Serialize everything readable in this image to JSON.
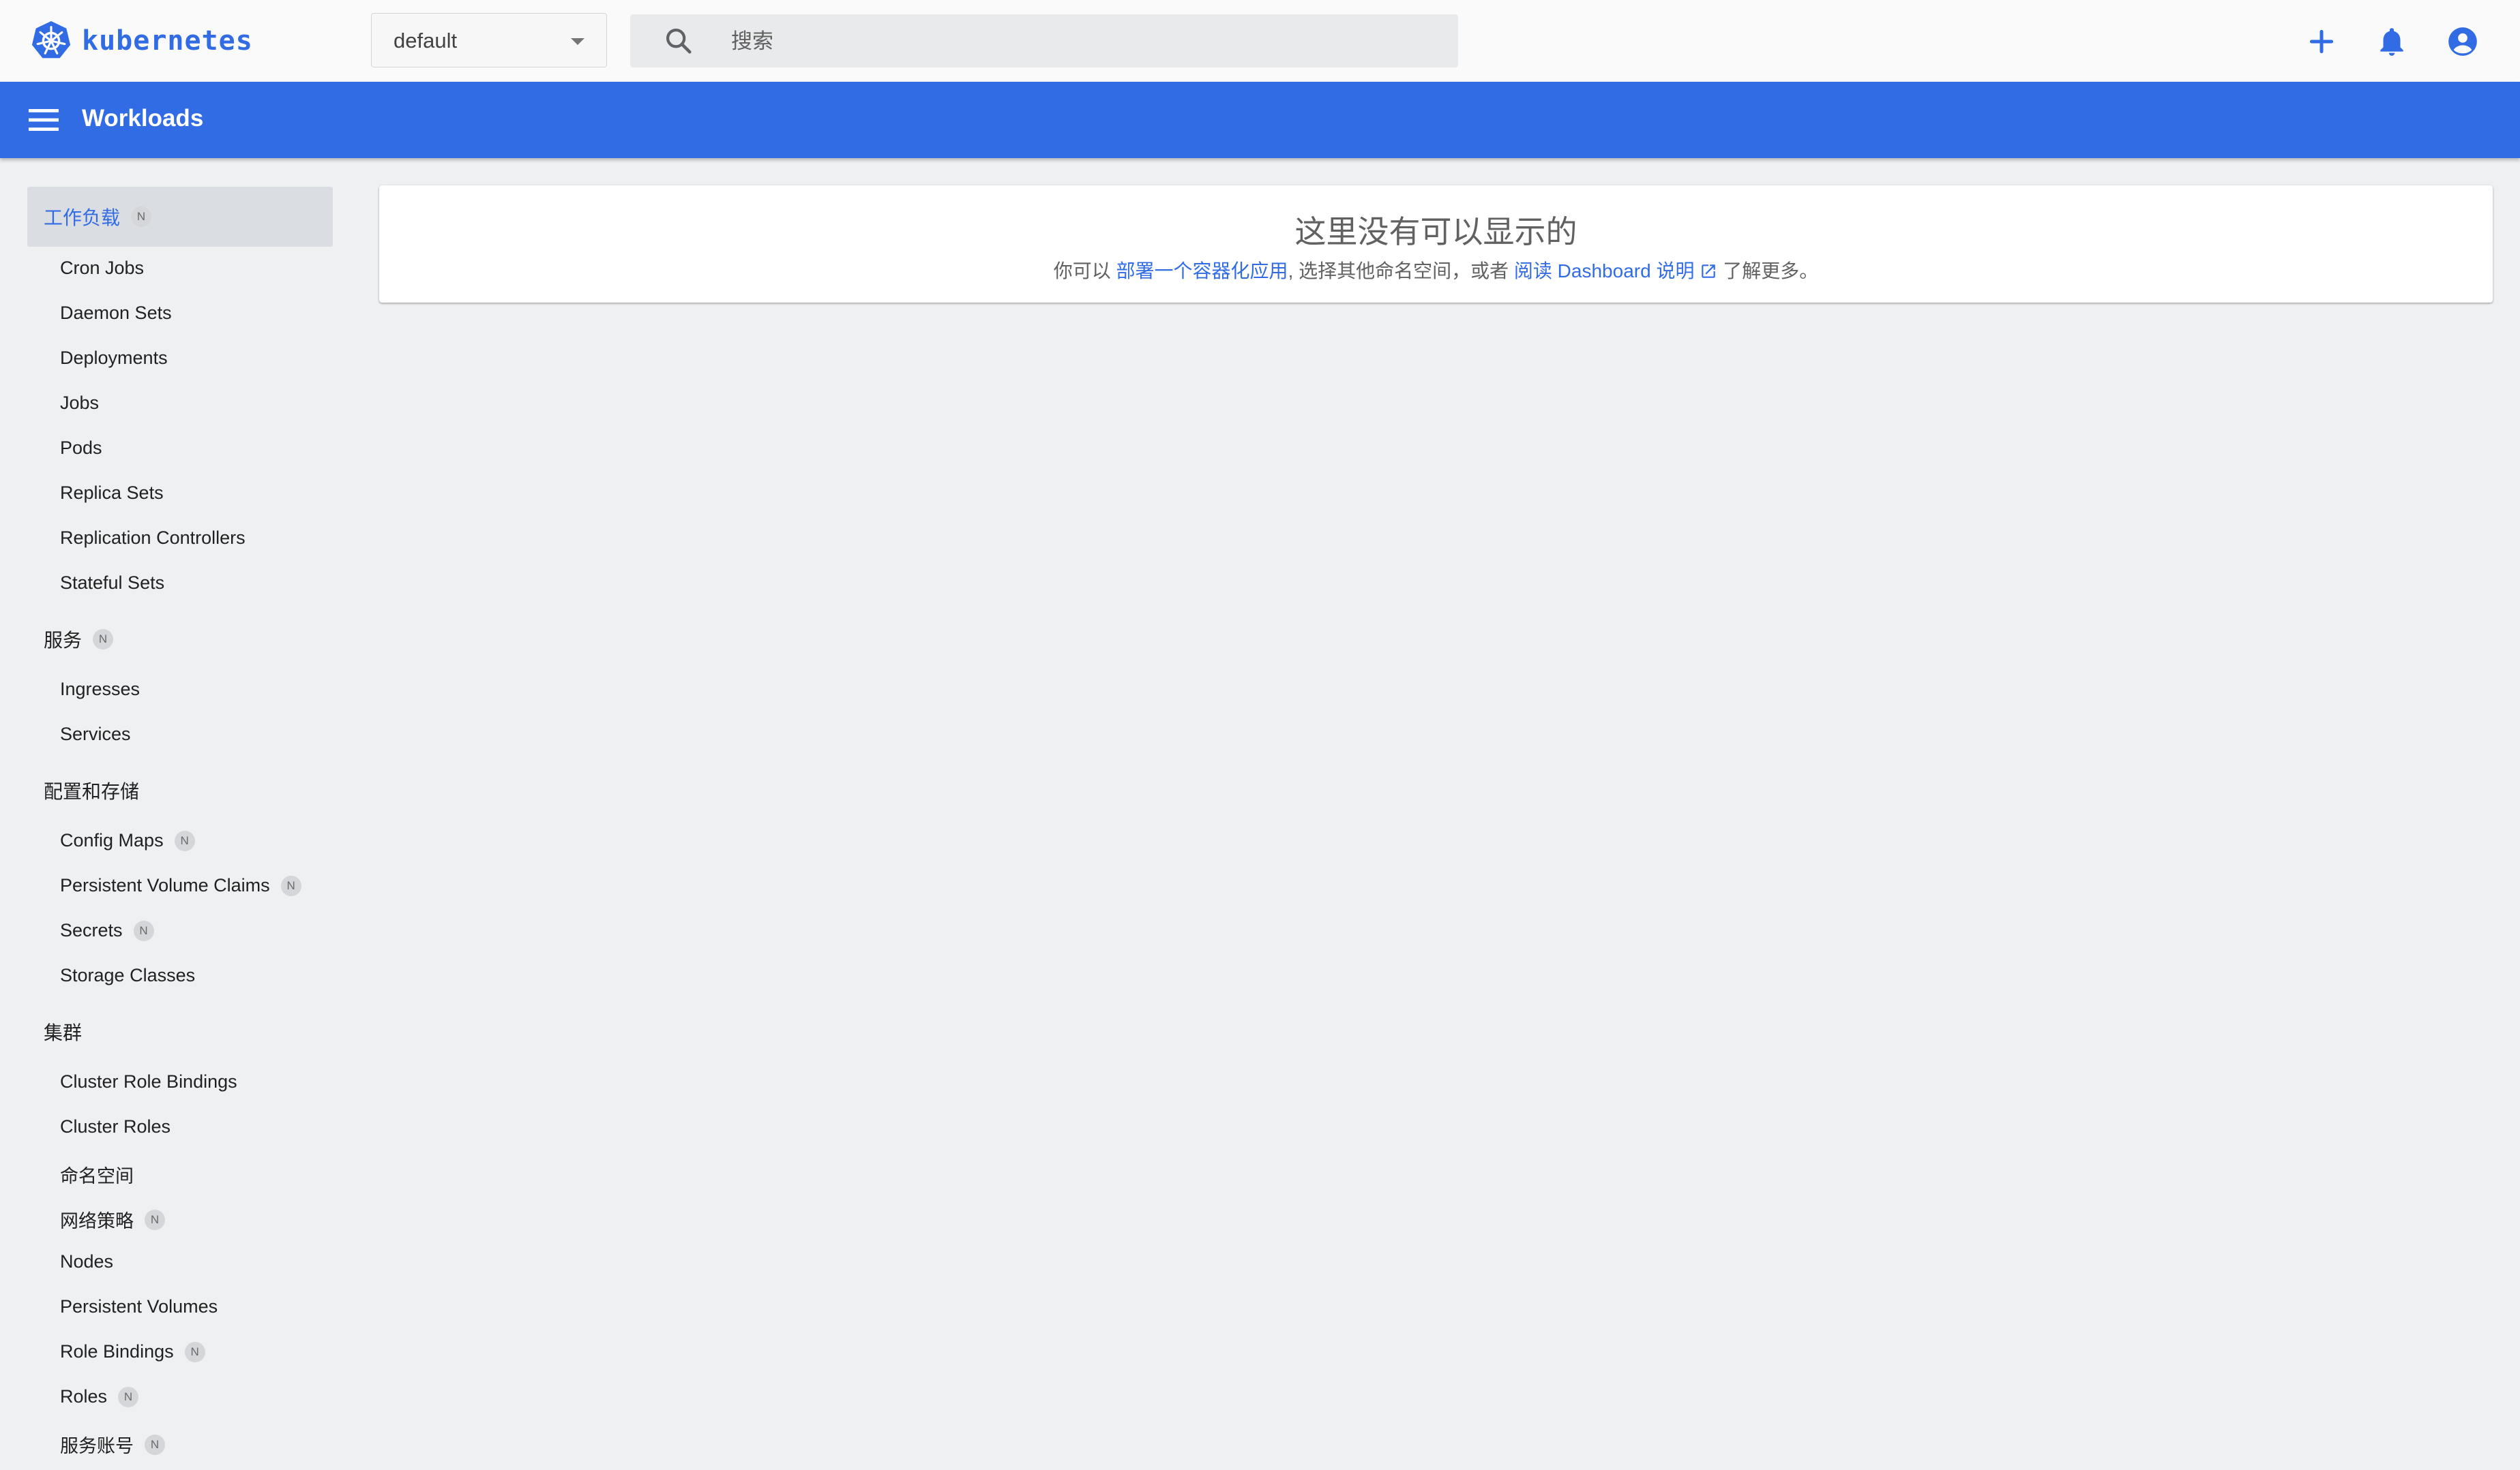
{
  "brand": {
    "name": "kubernetes",
    "accent": "#326ce5"
  },
  "toolbar": {
    "namespace": "default",
    "search_placeholder": "搜索",
    "create_icon": "plus-icon",
    "notifications_icon": "bell-icon",
    "account_icon": "account-circle-icon"
  },
  "appbar": {
    "title": "Workloads",
    "color": "#326ce5"
  },
  "sidebar": {
    "workloads": {
      "label": "工作负载",
      "badge": "N",
      "items": [
        "Cron Jobs",
        "Daemon Sets",
        "Deployments",
        "Jobs",
        "Pods",
        "Replica Sets",
        "Replication Controllers",
        "Stateful Sets"
      ]
    },
    "services": {
      "label": "服务",
      "badge": "N",
      "items": [
        "Ingresses",
        "Services"
      ]
    },
    "config": {
      "label": "配置和存储",
      "items": [
        {
          "label": "Config Maps",
          "badge": "N"
        },
        {
          "label": "Persistent Volume Claims",
          "badge": "N"
        },
        {
          "label": "Secrets",
          "badge": "N"
        },
        {
          "label": "Storage Classes"
        }
      ]
    },
    "cluster": {
      "label": "集群",
      "items": [
        {
          "label": "Cluster Role Bindings"
        },
        {
          "label": "Cluster Roles"
        },
        {
          "label": "命名空间"
        },
        {
          "label": "网络策略",
          "badge": "N"
        },
        {
          "label": "Nodes"
        },
        {
          "label": "Persistent Volumes"
        },
        {
          "label": "Role Bindings",
          "badge": "N"
        },
        {
          "label": "Roles",
          "badge": "N"
        },
        {
          "label": "服务账号",
          "badge": "N"
        }
      ]
    }
  },
  "empty_state": {
    "title": "这里没有可以显示的",
    "text_before": "你可以 ",
    "deploy_link": "部署一个容器化应用",
    "text_middle": ", 选择其他命名空间，或者 ",
    "docs_link": "阅读 Dashboard 说明",
    "text_after": " 了解更多。"
  }
}
